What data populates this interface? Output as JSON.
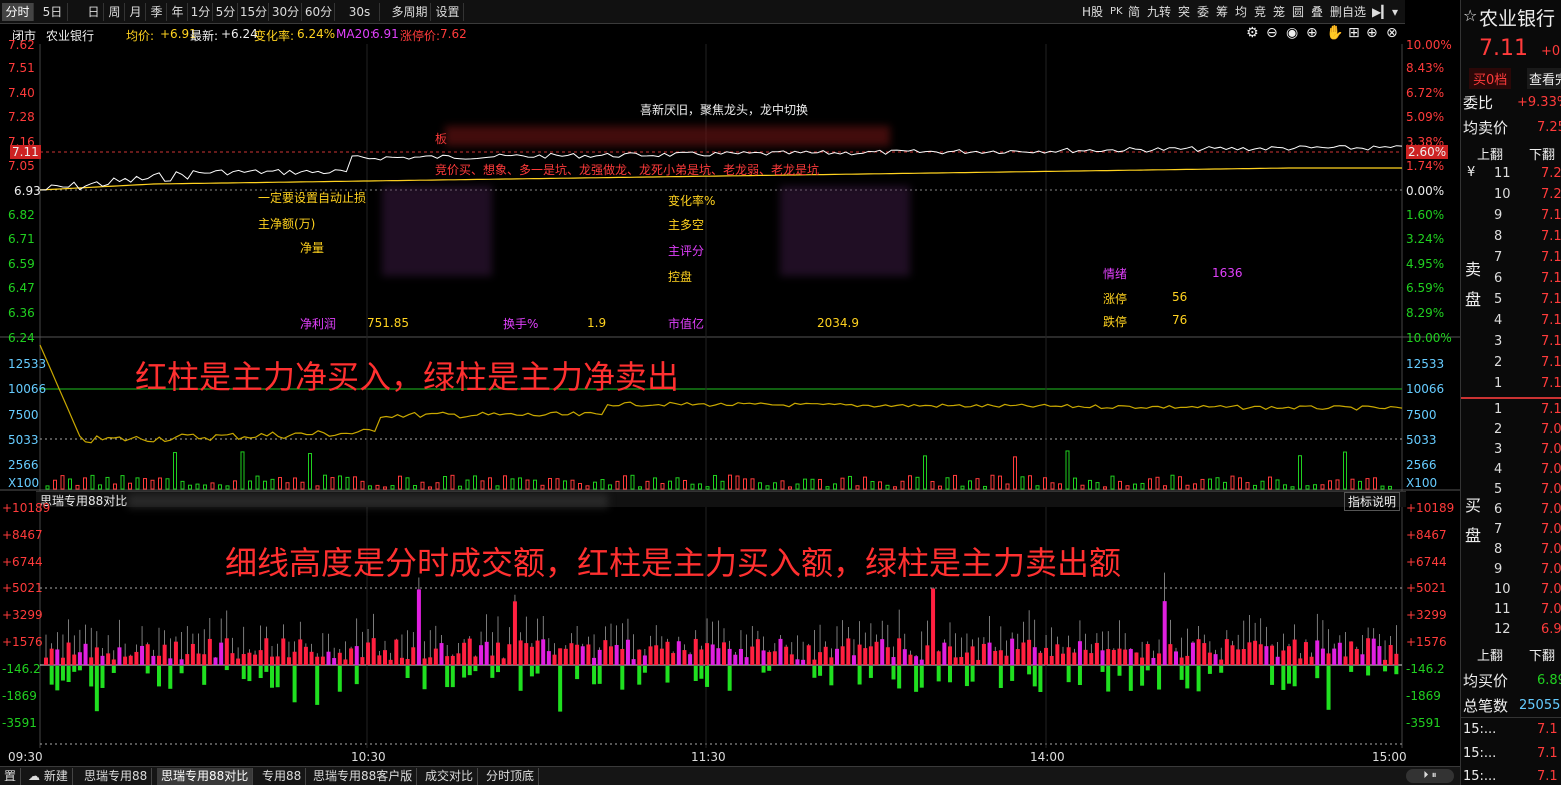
{
  "toolbar": {
    "periods": [
      "分时",
      "5日",
      "日",
      "周",
      "月",
      "季",
      "年",
      "1分",
      "5分",
      "15分",
      "30分",
      "60分",
      "30s",
      "多周期",
      "设置"
    ],
    "active_period": "分时",
    "right_tools": [
      "H股",
      "PK",
      "简",
      "九转",
      "突",
      "委",
      "筹",
      "均",
      "竞",
      "笼",
      "圆",
      "叠",
      "删自选"
    ]
  },
  "info_row": {
    "status": "闭市",
    "stock_name": "农业银行",
    "avg_label": "均价:",
    "avg_value": "+6.91",
    "latest_label": "最新:",
    "latest_value": "+6.24",
    "change_label": "变化率:",
    "change_value": "6.24%",
    "ma_label": "MA20:",
    "ma_value": "6.91",
    "limit_label": "涨停价:",
    "limit_value": "7.62"
  },
  "price_axis_left": [
    "7.62",
    "7.51",
    "7.40",
    "7.28",
    "7.16",
    "7.11",
    "7.05",
    "6.93",
    "6.82",
    "6.71",
    "6.59",
    "6.47",
    "6.36",
    "6.24"
  ],
  "pct_axis_right": [
    "10.00%",
    "8.43%",
    "6.72%",
    "5.09%",
    "3.38%",
    "2.60%",
    "1.74%",
    "0.00%",
    "1.60%",
    "3.24%",
    "4.95%",
    "6.59%",
    "8.29%",
    "10.00%"
  ],
  "mid_axis_left": [
    "12533",
    "10066",
    "7500",
    "5033",
    "2566",
    "X100"
  ],
  "mid_axis_right": [
    "12533",
    "10066",
    "7500",
    "5033",
    "2566",
    "X100"
  ],
  "lower_axis": [
    "+10189",
    "+8467",
    "+6744",
    "+5021",
    "+3299",
    "+1576",
    "-146.2",
    "-1869",
    "-3591"
  ],
  "time_axis": [
    "09:30",
    "10:30",
    "11:30",
    "14:00",
    "15:00"
  ],
  "annotations": {
    "headline": "喜新厌旧，聚焦龙头，龙中切换",
    "line1_prefix": "板",
    "line2": "竞价买、想象、多一是坑、龙强做龙、龙死小弟是坑、老龙弱、老龙是坑",
    "stop_loss": "一定要设置自动止损",
    "net_amount": "主净额(万)",
    "net_volume": "净量",
    "change_rate": "变化率%",
    "main_long_short": "主多空",
    "main_score": "主评分",
    "control": "控盘",
    "sentiment_label": "情绪",
    "sentiment_value": "1636",
    "limit_up_label": "涨停",
    "limit_up_value": "56",
    "limit_down_label": "跌停",
    "limit_down_value": "76",
    "net_profit_label": "净利润",
    "net_profit_value": "751.85",
    "turnover_label": "换手%",
    "turnover_value": "1.9",
    "market_cap_label": "市值亿",
    "market_cap_value": "2034.9"
  },
  "overlay_text": {
    "top": "红柱是主力净买入，绿柱是主力净卖出",
    "bottom": "细线高度是分时成交额，红柱是主力买入额，绿柱是主力卖出额"
  },
  "indicator_bar": {
    "name": "思瑞专用88对比",
    "help": "指标说明"
  },
  "bottom_tabs": [
    "置",
    "新建",
    "思瑞专用88",
    "思瑞专用88对比",
    "专用88",
    "思瑞专用88客户版",
    "成交对比",
    "分时顶底"
  ],
  "active_tab": "思瑞专用88对比",
  "right_panel": {
    "title": "农业银行",
    "price": "7.11",
    "change": "+0.",
    "buy_label": "买0档",
    "view_label": "查看完",
    "wei_bi_label": "委比",
    "wei_bi_value": "+9.33%",
    "avg_sell_label": "均卖价",
    "avg_sell_value": "7.25",
    "up_label": "上翻",
    "down_label": "下翻",
    "sell_side_label_1": "卖",
    "sell_side_label_2": "盘",
    "buy_side_label_1": "买",
    "buy_side_label_2": "盘",
    "yen": "¥",
    "sell_levels": [
      {
        "n": "11",
        "p": "7.2"
      },
      {
        "n": "10",
        "p": "7.2"
      },
      {
        "n": "9",
        "p": "7.1"
      },
      {
        "n": "8",
        "p": "7.1"
      },
      {
        "n": "7",
        "p": "7.1"
      },
      {
        "n": "6",
        "p": "7.1"
      },
      {
        "n": "5",
        "p": "7.1"
      },
      {
        "n": "4",
        "p": "7.1"
      },
      {
        "n": "3",
        "p": "7.1"
      },
      {
        "n": "2",
        "p": "7.1"
      },
      {
        "n": "1",
        "p": "7.1"
      }
    ],
    "buy_levels": [
      {
        "n": "1",
        "p": "7.1"
      },
      {
        "n": "2",
        "p": "7.0"
      },
      {
        "n": "3",
        "p": "7.0"
      },
      {
        "n": "4",
        "p": "7.0"
      },
      {
        "n": "5",
        "p": "7.0"
      },
      {
        "n": "6",
        "p": "7.0"
      },
      {
        "n": "7",
        "p": "7.0"
      },
      {
        "n": "8",
        "p": "7.0"
      },
      {
        "n": "9",
        "p": "7.0"
      },
      {
        "n": "10",
        "p": "7.0"
      },
      {
        "n": "11",
        "p": "7.0"
      },
      {
        "n": "12",
        "p": "6.9"
      }
    ],
    "avg_buy_label": "均买价",
    "avg_buy_value": "6.89",
    "total_label": "总笔数",
    "total_value": "25055",
    "ticks": [
      {
        "t": "15:...",
        "v": "7.1"
      },
      {
        "t": "15:...",
        "v": "7.1"
      },
      {
        "t": "15:...",
        "v": "7.1"
      }
    ]
  },
  "colors": {
    "up": "#ff3b3b",
    "down": "#20d020",
    "price_line": "#ffffff",
    "avg_line": "#ffd21f",
    "main_line": "#e040fb",
    "magenta": "#e020e0"
  }
}
